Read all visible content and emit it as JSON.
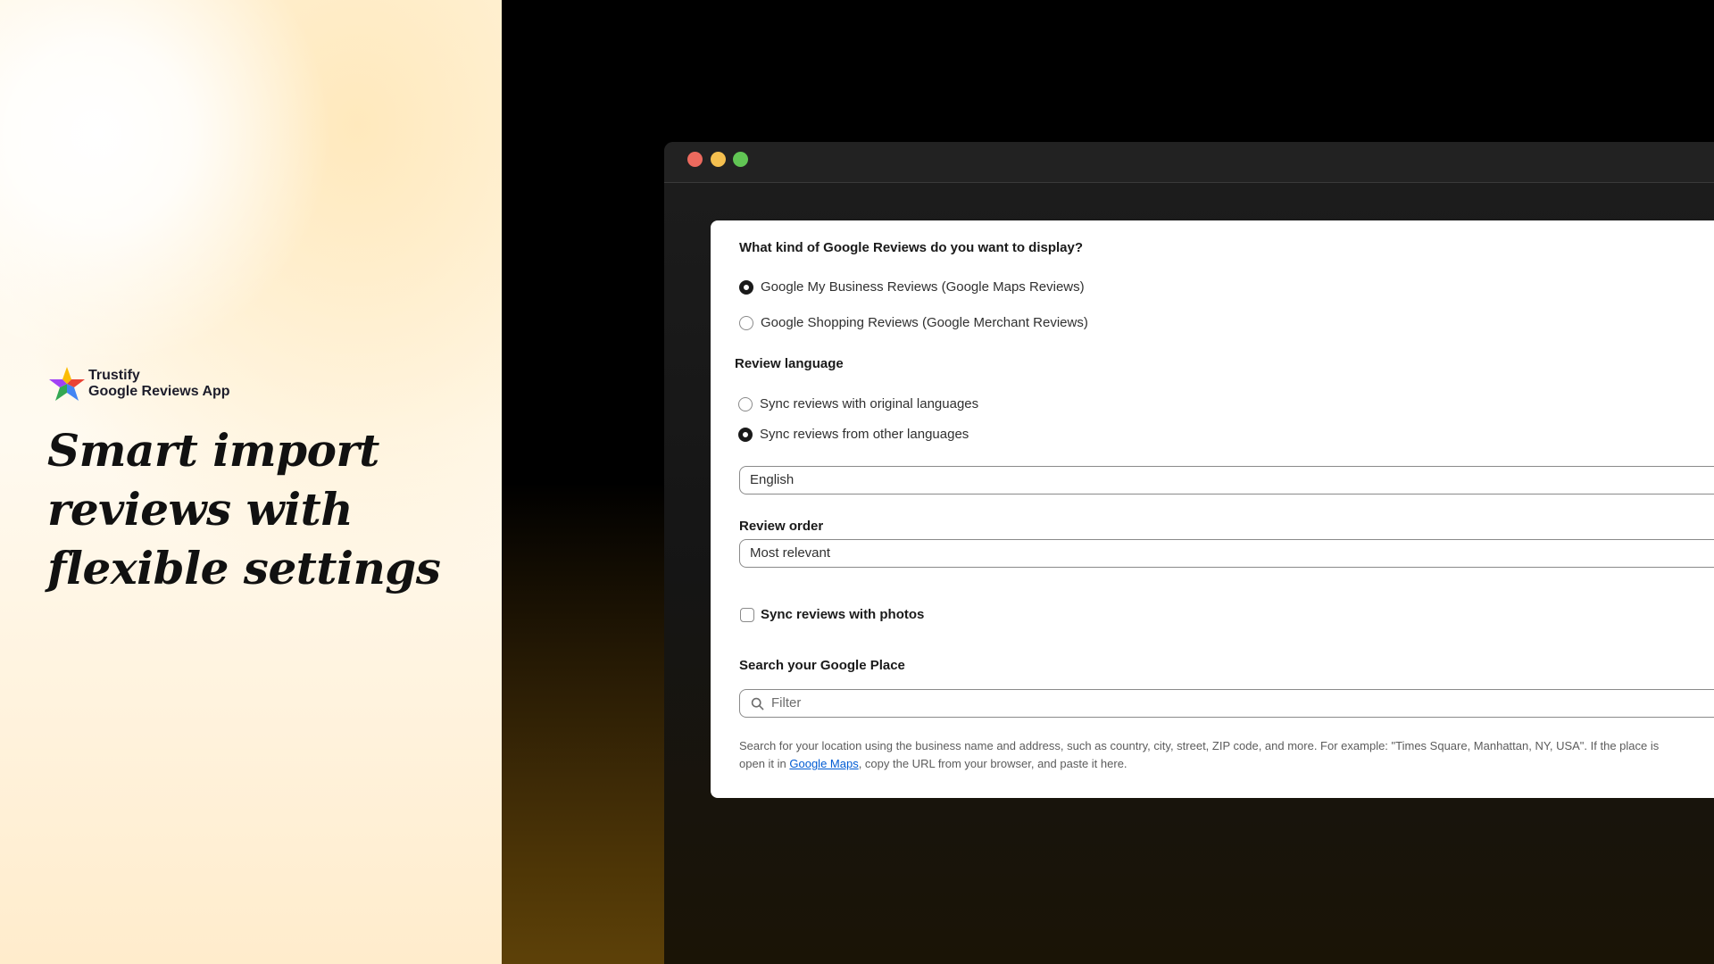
{
  "brand": {
    "name": "Trustify",
    "product": "Google Reviews App"
  },
  "headline": {
    "line1": "Smart import",
    "line2": "reviews with",
    "line3": "flexible settings"
  },
  "form": {
    "review_type": {
      "question": "What kind of Google Reviews do you want to display?",
      "options": [
        {
          "label": "Google My Business Reviews (Google Maps Reviews)",
          "checked": true
        },
        {
          "label": "Google Shopping Reviews (Google Merchant Reviews)",
          "checked": false
        }
      ]
    },
    "review_language": {
      "label": "Review language",
      "options": [
        {
          "label": "Sync reviews with original languages",
          "checked": false
        },
        {
          "label": "Sync reviews from other languages",
          "checked": true
        }
      ],
      "selected_language": "English"
    },
    "review_order": {
      "label": "Review order",
      "selected": "Most relevant"
    },
    "sync_photos": {
      "label": "Sync reviews with photos",
      "checked": false
    },
    "place_search": {
      "label": "Search your Google Place",
      "placeholder": "Filter",
      "help_part1": "Search for your location using the business name and address, such as country, city, street, ZIP code, and more. For example: \"Times Square, Manhattan, NY, USA\". If the place is",
      "help_part2": "open it in ",
      "help_link": "Google Maps",
      "help_part3": ", copy the URL from your browser, and paste it here."
    }
  },
  "colors": {
    "traffic_red": "#ec6a5e",
    "traffic_yellow": "#f4bf4f",
    "traffic_green": "#61c554",
    "link": "#005bd3"
  }
}
